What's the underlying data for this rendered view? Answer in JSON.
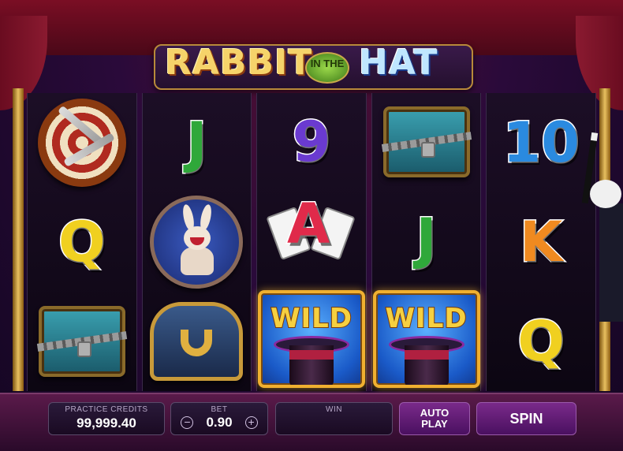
{
  "game": {
    "title_part1": "RABBIT",
    "title_part2": "IN THE",
    "title_part3": "HAT"
  },
  "reels": [
    [
      "target-symbol",
      "letter-Q",
      "chest-symbol"
    ],
    [
      "letter-J",
      "rabbit-symbol",
      "trunk-symbol"
    ],
    [
      "number-9",
      "letter-A",
      "wild"
    ],
    [
      "chest-symbol",
      "letter-J",
      "wild"
    ],
    [
      "number-10",
      "letter-K",
      "letter-Q"
    ]
  ],
  "symbols": {
    "r1": {
      "q": "Q"
    },
    "r2": {
      "j": "J"
    },
    "r3": {
      "nine": "9",
      "a": "A",
      "wild": "WILD"
    },
    "r4": {
      "j": "J",
      "wild": "WILD"
    },
    "r5": {
      "ten": "10",
      "k": "K",
      "q": "Q"
    }
  },
  "colors": {
    "wild_border": "#f0b030",
    "button_bg": "#4a1060",
    "accent_gold": "#f6d36a"
  },
  "controls": {
    "credits_label": "PRACTICE CREDITS",
    "credits_value": "99,999.40",
    "bet_label": "BET",
    "bet_value": "0.90",
    "bet_minus": "−",
    "bet_plus": "+",
    "win_label": "WIN",
    "win_value": "",
    "autoplay_label": "AUTO PLAY",
    "spin_label": "SPIN"
  }
}
